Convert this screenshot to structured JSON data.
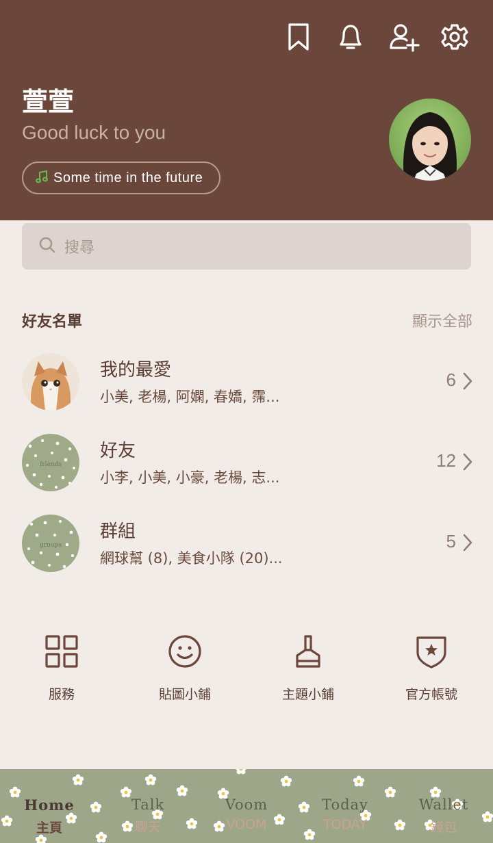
{
  "header": {
    "icons": [
      "bookmark-icon",
      "bell-icon",
      "add-friend-icon",
      "gear-icon"
    ],
    "profile_name": "萱萱",
    "status_message": "Good luck to you",
    "music_label": "Some time in the future",
    "background_color": "#6b473b"
  },
  "search": {
    "placeholder": "搜尋"
  },
  "friends_section": {
    "title": "好友名單",
    "show_all": "顯示全部",
    "rows": [
      {
        "title": "我的最愛",
        "subtitle": "小美, 老楊, 阿嫻, 春嬌, 霈...",
        "count": "6"
      },
      {
        "title": "好友",
        "subtitle": "小李, 小美, 小豪, 老楊, 志...",
        "count": "12"
      },
      {
        "title": "群組",
        "subtitle": "網球幫 (8), 美食小隊 (20)...",
        "count": "5"
      }
    ]
  },
  "shortcuts": [
    {
      "label": "服務",
      "icon": "grid-icon"
    },
    {
      "label": "貼圖小鋪",
      "icon": "smiley-icon"
    },
    {
      "label": "主題小鋪",
      "icon": "brush-icon"
    },
    {
      "label": "官方帳號",
      "icon": "shield-star-icon"
    }
  ],
  "bottom_nav": [
    {
      "en": "Home",
      "zh": "主頁",
      "active": true
    },
    {
      "en": "Talk",
      "zh": "聊天",
      "active": false
    },
    {
      "en": "Voom",
      "zh": "VOOM",
      "active": false
    },
    {
      "en": "Today",
      "zh": "TODAY",
      "active": false
    },
    {
      "en": "Wallet",
      "zh": "錢包",
      "active": false
    }
  ],
  "colors": {
    "accent": "#6b473b",
    "page_background": "#f1ece7",
    "nav_background": "#9ea68a"
  }
}
